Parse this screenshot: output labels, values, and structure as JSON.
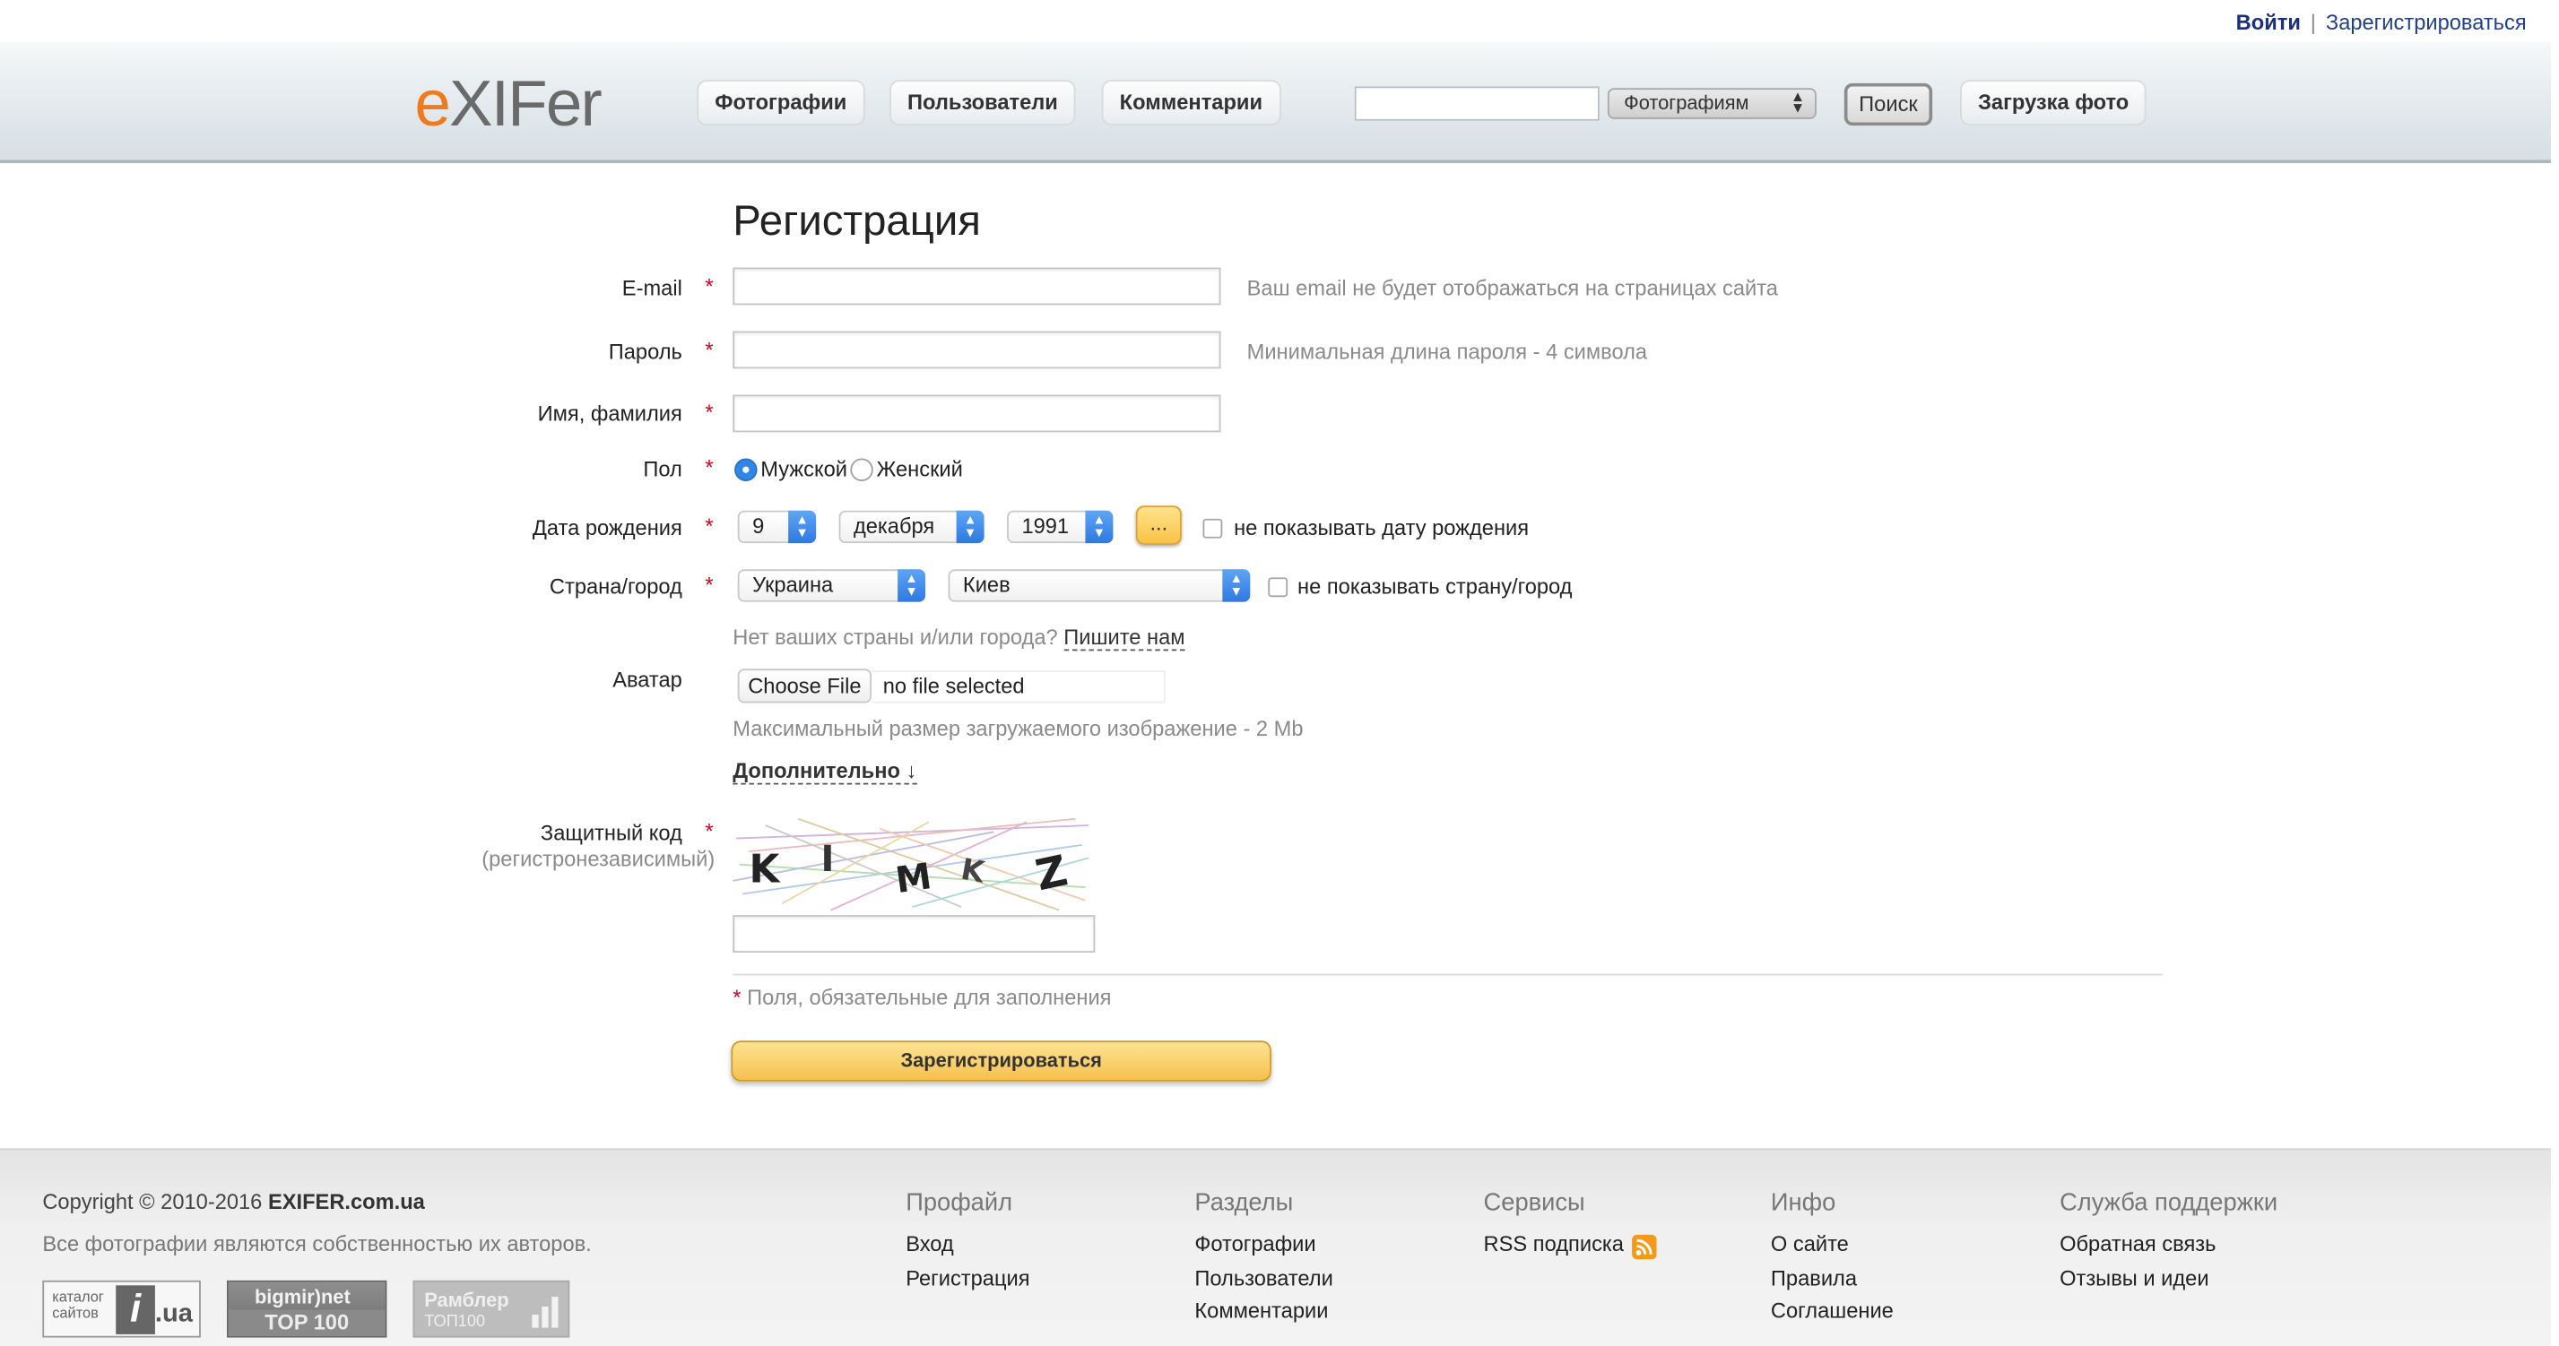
{
  "top_links": {
    "login": "Войти",
    "separator": "|",
    "register": "Зарегистрироваться"
  },
  "header": {
    "logo": {
      "e": "e",
      "rest": "XIFer"
    },
    "nav": [
      "Фотографии",
      "Пользователи",
      "Комментарии"
    ],
    "search": {
      "input_value": "",
      "scope_selected": "Фотографиям",
      "button_label": "Поиск"
    },
    "upload_label": "Загрузка фото"
  },
  "form": {
    "title": "Регистрация",
    "required_mark": "*",
    "email": {
      "label": "E-mail",
      "value": "",
      "hint": "Ваш email не будет отображаться на страницах сайта"
    },
    "password": {
      "label": "Пароль",
      "value": "",
      "hint": "Минимальная длина пароля - 4 символа"
    },
    "name": {
      "label": "Имя, фамилия",
      "value": ""
    },
    "gender": {
      "label": "Пол",
      "options": [
        "Мужской",
        "Женский"
      ],
      "selected": "Мужской"
    },
    "birth": {
      "label": "Дата рождения",
      "day": "9",
      "month": "декабря",
      "year": "1991",
      "picker_label": "...",
      "hide_label": "не показывать дату рождения",
      "hide_checked": false
    },
    "location": {
      "label": "Страна/город",
      "country": "Украина",
      "city": "Киев",
      "hide_label": "не показывать страну/город",
      "hide_checked": false
    },
    "no_location": {
      "text": "Нет ваших страны и/или города?",
      "link": "Пишите нам"
    },
    "avatar": {
      "label": "Аватар",
      "button": "Choose File",
      "status": "no file selected",
      "hint": "Максимальный размер загружаемого изображение - 2 Mb"
    },
    "more_link": "Дополнительно ↓",
    "captcha": {
      "label": "Защитный код",
      "sublabel": "(регистронезависимый)",
      "letters": [
        "K",
        "I",
        "M",
        "K",
        "Z"
      ],
      "value": ""
    },
    "required_note": "Поля, обязательные для заполнения",
    "submit": "Зарегистрироваться"
  },
  "footer": {
    "copyright_prefix": "Copyright © 2010-2016",
    "copyright_site": "EXIFER.com.ua",
    "photos_note": "Все фотографии являются собственностью их авторов.",
    "badges": {
      "iua": {
        "top": "каталог",
        "bottom": "сайтов",
        "mark": "i",
        "domain": ".ua"
      },
      "bigmir": {
        "top": "bigmir)net",
        "bottom": "TOP 100"
      },
      "rambler": {
        "top": "Рамблер",
        "bottom": "ТОП100"
      }
    },
    "columns": [
      {
        "title": "Профайл",
        "links": [
          "Вход",
          "Регистрация"
        ]
      },
      {
        "title": "Разделы",
        "links": [
          "Фотографии",
          "Пользователи",
          "Комментарии"
        ]
      },
      {
        "title": "Сервисы",
        "links": [
          "RSS подписка"
        ]
      },
      {
        "title": "Инфо",
        "links": [
          "О сайте",
          "Правила",
          "Соглашение"
        ]
      },
      {
        "title": "Служба поддержки",
        "links": [
          "Обратная связь",
          "Отзывы и идеи"
        ]
      }
    ]
  },
  "colors": {
    "accent_orange": "#f07a1f",
    "link_blue": "#1f3f8f",
    "required_red": "#d0021b",
    "button_yellow": "#f5c04d"
  }
}
